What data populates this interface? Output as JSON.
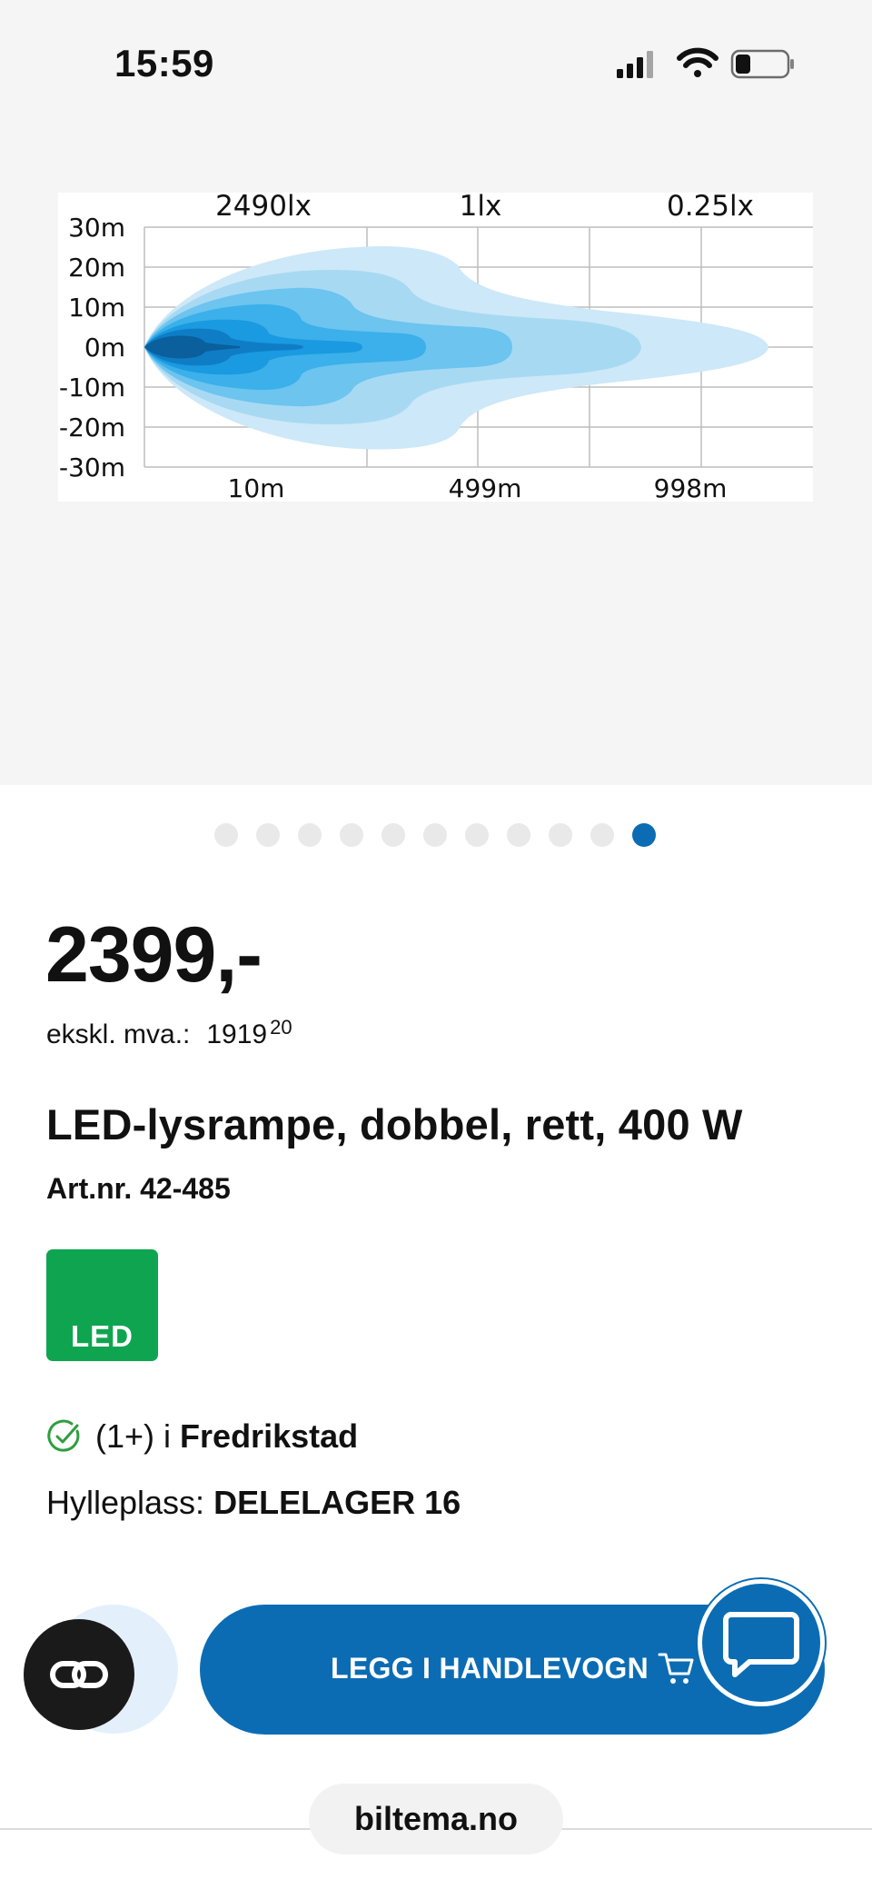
{
  "status_bar": {
    "time": "15:59",
    "icons": [
      "signal-icon",
      "wifi-icon",
      "battery-icon"
    ]
  },
  "gallery": {
    "image_count": 11,
    "active_index": 10,
    "beam_chart": {
      "top_labels": [
        "2490lx",
        "1lx",
        "0.25lx"
      ],
      "y_labels": [
        "30m",
        "20m",
        "10m",
        "0m",
        "-10m",
        "-20m",
        "-30m"
      ],
      "x_labels": [
        "10m",
        "499m",
        "998m"
      ],
      "colors": [
        "#cde8f8",
        "#a8d9f3",
        "#6cc4ef",
        "#3bb0ea",
        "#1a9ae0",
        "#0f7dc6",
        "#0a5f9c"
      ]
    }
  },
  "product": {
    "price": "2399,-",
    "ex_vat_label": "ekskl. mva.:",
    "ex_vat_amount": "1919",
    "ex_vat_cents": "20",
    "title": "LED-lysrampe, dobbel, rett, 400 W",
    "art_nr": "Art.nr. 42-485",
    "badge": "LED",
    "badge_color": "#0fa550"
  },
  "stock": {
    "count": "(1+) i",
    "store": "Fredrikstad",
    "shelf_label": "Hylleplass:",
    "shelf_value": "DELELAGER 16"
  },
  "actions": {
    "add_to_cart": "LEGG I HANDLEVOGN",
    "accent_color": "#0b6cb4"
  },
  "browser": {
    "url": "biltema.no"
  }
}
